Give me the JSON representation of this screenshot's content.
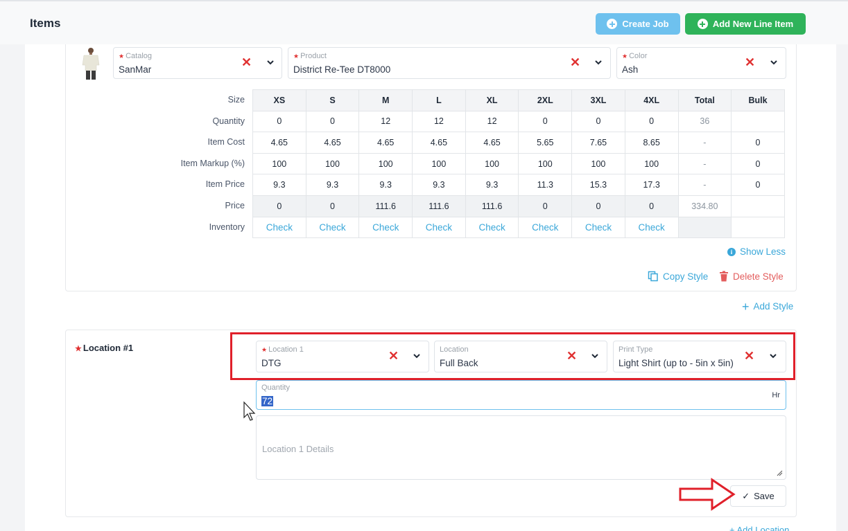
{
  "header": {
    "title": "Items",
    "create_job_label": "Create Job",
    "add_line_item_label": "Add New Line Item"
  },
  "style": {
    "catalog": {
      "label": "Catalog",
      "value": "SanMar"
    },
    "product": {
      "label": "Product",
      "value": "District Re-Tee DT8000"
    },
    "color": {
      "label": "Color",
      "value": "Ash"
    },
    "row_labels": [
      "Size",
      "Quantity",
      "Item Cost",
      "Item Markup (%)",
      "Item Price",
      "Price",
      "Inventory"
    ],
    "sizes": [
      "XS",
      "S",
      "M",
      "L",
      "XL",
      "2XL",
      "3XL",
      "4XL",
      "Total",
      "Bulk"
    ],
    "rows": {
      "quantity": [
        "0",
        "0",
        "12",
        "12",
        "12",
        "0",
        "0",
        "0",
        "36",
        ""
      ],
      "item_cost": [
        "4.65",
        "4.65",
        "4.65",
        "4.65",
        "4.65",
        "5.65",
        "7.65",
        "8.65",
        "-",
        "0"
      ],
      "item_markup": [
        "100",
        "100",
        "100",
        "100",
        "100",
        "100",
        "100",
        "100",
        "-",
        "0"
      ],
      "item_price": [
        "9.3",
        "9.3",
        "9.3",
        "9.3",
        "9.3",
        "11.3",
        "15.3",
        "17.3",
        "-",
        "0"
      ],
      "price": [
        "0",
        "0",
        "111.6",
        "111.6",
        "111.6",
        "0",
        "0",
        "0",
        "334.80",
        ""
      ],
      "inventory": [
        "Check",
        "Check",
        "Check",
        "Check",
        "Check",
        "Check",
        "Check",
        "Check",
        "",
        ""
      ]
    },
    "show_less_label": "Show Less",
    "copy_style_label": "Copy Style",
    "delete_style_label": "Delete Style",
    "add_style_label": "Add Style"
  },
  "location": {
    "title": "Location #1",
    "location1": {
      "label": "Location 1",
      "value": "DTG"
    },
    "location": {
      "label": "Location",
      "value": "Full Back"
    },
    "print_type": {
      "label": "Print Type",
      "value": "Light Shirt (up to - 5in x 5in)"
    },
    "quantity": {
      "label": "Quantity",
      "value": "72",
      "unit": "Hr"
    },
    "details_placeholder": "Location 1 Details",
    "save_label": "Save",
    "add_location_label": "Add Location"
  },
  "colors": {
    "accent": "#3aa7d9",
    "create_job_bg": "#6ec1ee",
    "add_line_bg": "#2fb35a",
    "danger": "#e03131",
    "annotation": "#e0202a"
  }
}
